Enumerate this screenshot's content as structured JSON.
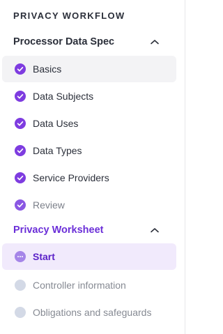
{
  "workflow": {
    "title": "PRIVACY WORKFLOW"
  },
  "sections": [
    {
      "label": "Processor Data Spec",
      "expanded": true,
      "steps": [
        {
          "label": "Basics",
          "state": "complete"
        },
        {
          "label": "Data Subjects",
          "state": "complete"
        },
        {
          "label": "Data Uses",
          "state": "complete"
        },
        {
          "label": "Data Types",
          "state": "complete"
        },
        {
          "label": "Service Providers",
          "state": "complete"
        },
        {
          "label": "Review",
          "state": "complete"
        }
      ]
    },
    {
      "label": "Privacy Worksheet",
      "expanded": true,
      "steps": [
        {
          "label": "Start",
          "state": "in-progress"
        },
        {
          "label": "Controller information",
          "state": "pending"
        },
        {
          "label": "Obligations and safeguards",
          "state": "pending"
        }
      ]
    }
  ],
  "colors": {
    "accent": "#7e3ce0",
    "accent_dark": "#5b21c8",
    "pending": "#d3d9e6"
  },
  "icons": {
    "complete": "check-circle-icon",
    "in-progress": "ellipsis-circle-icon",
    "pending": "empty-circle-icon",
    "collapse": "chevron-up-icon"
  }
}
